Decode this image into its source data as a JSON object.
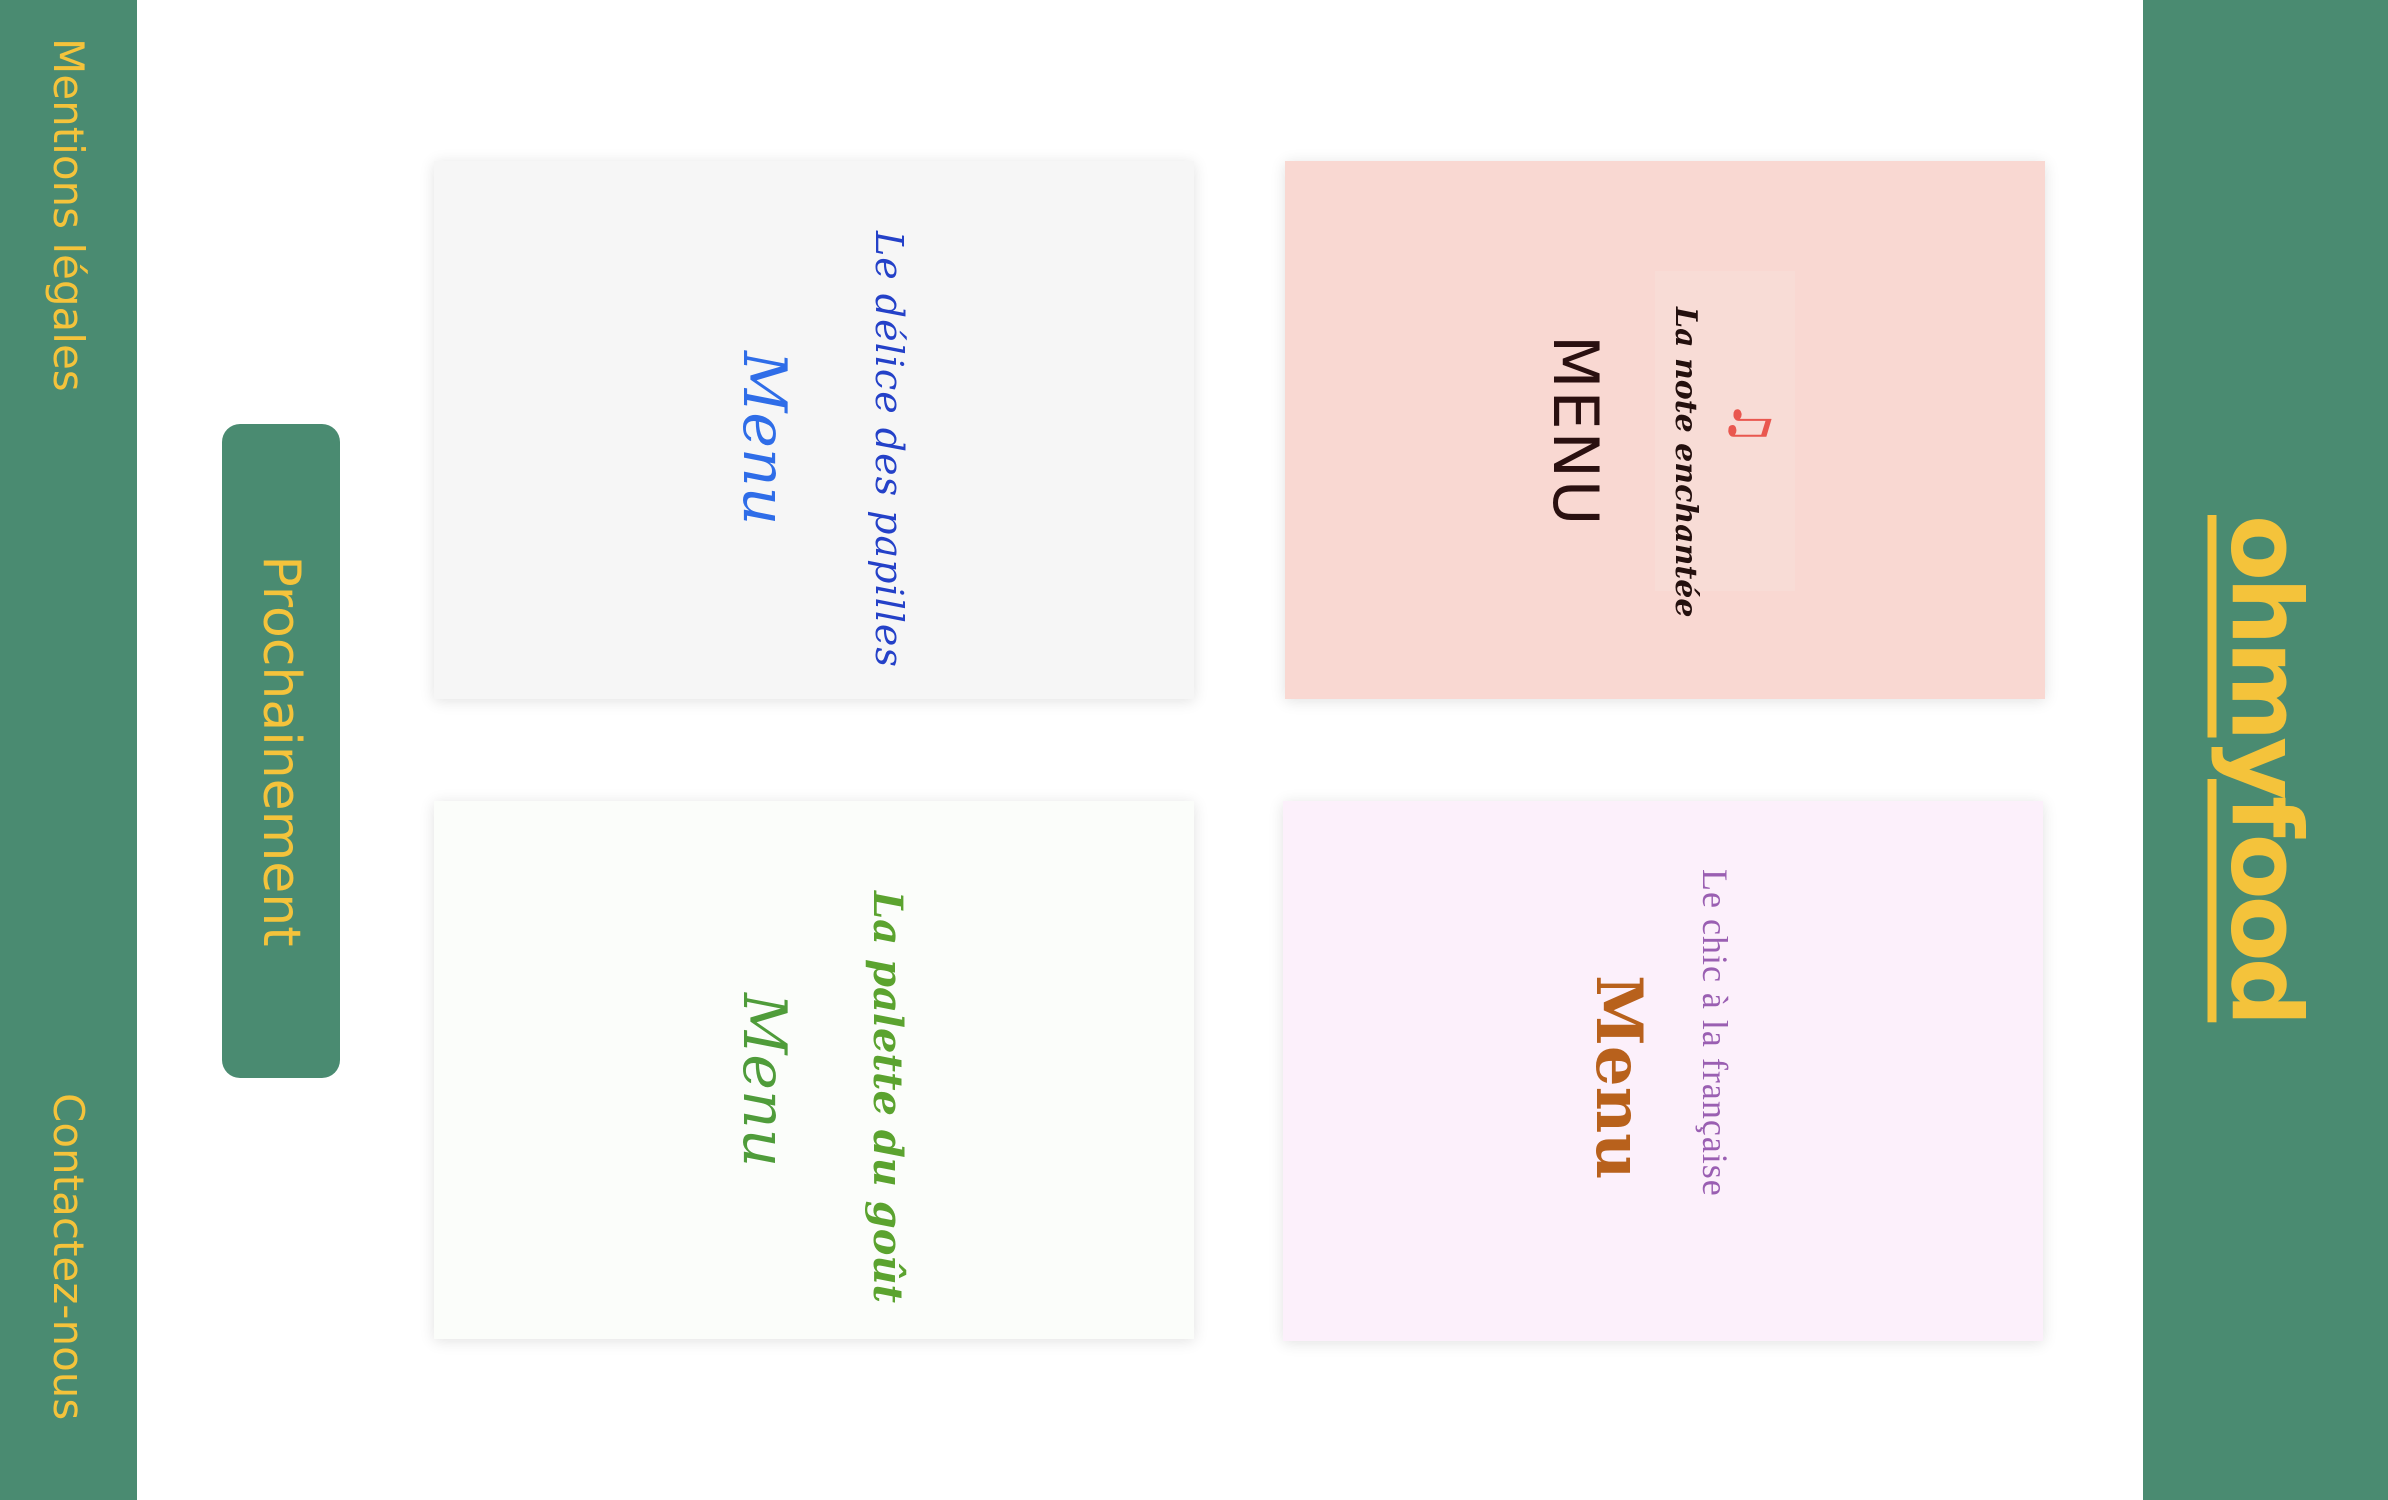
{
  "header": {
    "logo": "ohmyfood"
  },
  "footer": {
    "links": [
      {
        "label": "Mentions légales"
      },
      {
        "label": "Contactez-nous"
      }
    ]
  },
  "coming_soon": {
    "label": "Prochainement"
  },
  "cards": [
    {
      "name": "Le délice des papilles",
      "menu_label": "Menu",
      "background": "#f6f6f6",
      "accent": "#2f6de8"
    },
    {
      "name": "La note enchantée",
      "menu_label": "MENU",
      "icon": "music-note-icon",
      "background": "#f9d8d2",
      "accent": "#e9574f"
    },
    {
      "name": "La palette du goût",
      "menu_label": "Menu",
      "background": "#fbfdfa",
      "accent": "#5ba32f"
    },
    {
      "name": "Le chic à la française",
      "menu_label": "Menu",
      "background": "#fcf0fb",
      "accent": "#b8611c"
    }
  ],
  "colors": {
    "brand_green": "#4a8b71",
    "brand_yellow": "#f4c33b"
  }
}
